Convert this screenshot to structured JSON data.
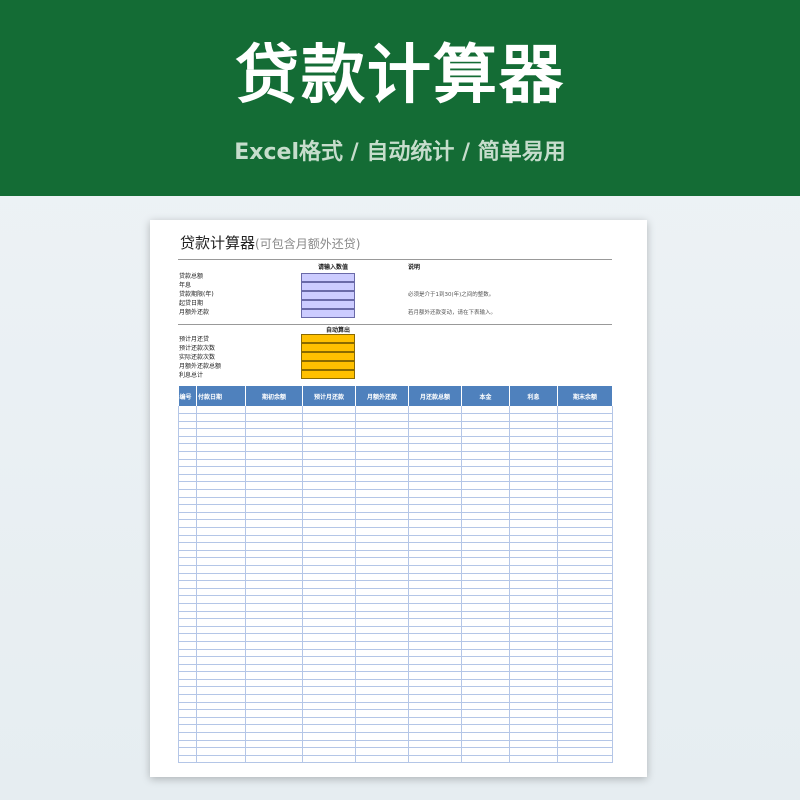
{
  "banner": {
    "title": "贷款计算器",
    "subtitle": "Excel格式 / 自动统计 / 简单易用"
  },
  "sheet": {
    "title": "贷款计算器",
    "title_sub": "(可包含月额外还贷)",
    "input_header": "请输入数值",
    "note_header": "说明",
    "input_labels": [
      "贷款总额",
      "年息",
      "贷款期限(年)",
      "起贷日期",
      "月额外还款"
    ],
    "notes": {
      "term_note": "必须是介于1到30(年)之间的整数。",
      "extra_note": "若月额外还款变动，请在下表输入。"
    },
    "output_header": "自动算出",
    "output_labels": [
      "预计月还贷",
      "预计还款次数",
      "实际还款次数",
      "月额外还款总额",
      "利息总计"
    ],
    "table_headers": [
      "编号",
      "付款日期",
      "期初余额",
      "预计月还款",
      "月额外还款",
      "月还款总额",
      "本金",
      "利息",
      "期末余额"
    ]
  },
  "colors": {
    "banner_green": "#146c35",
    "input_fill": "#ccccff",
    "output_fill": "#ffc000",
    "table_header_blue": "#4f81bd"
  }
}
